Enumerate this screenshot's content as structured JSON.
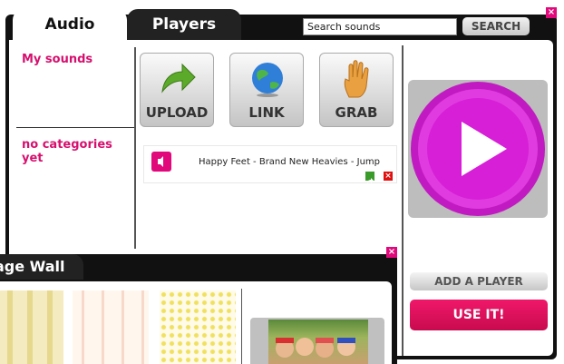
{
  "audio_window": {
    "tabs": [
      {
        "label": "Audio",
        "active": true
      },
      {
        "label": "Players",
        "active": false
      }
    ],
    "search": {
      "value": "Search sounds",
      "button_label": "SEARCH"
    },
    "close_label": "×",
    "sidebar": {
      "my_sounds_label": "My sounds",
      "categories_label": "no categories yet"
    },
    "actions": [
      {
        "label": "UPLOAD",
        "icon": "green-arrow-icon"
      },
      {
        "label": "LINK",
        "icon": "globe-icon"
      },
      {
        "label": "GRAB",
        "icon": "hand-icon"
      }
    ],
    "sound_list": [
      {
        "title": "Happy Feet - Brand New Heavies - Jump",
        "icon": "speaker-icon"
      }
    ],
    "player": {
      "add_player_label": "ADD A PLAYER",
      "use_it_label": "USE IT!"
    },
    "colors": {
      "accent_pink": "#e0087a",
      "play_magenta": "#d61fd6"
    }
  },
  "wall_window": {
    "tab_label": "age Wall",
    "close_label": "×"
  }
}
